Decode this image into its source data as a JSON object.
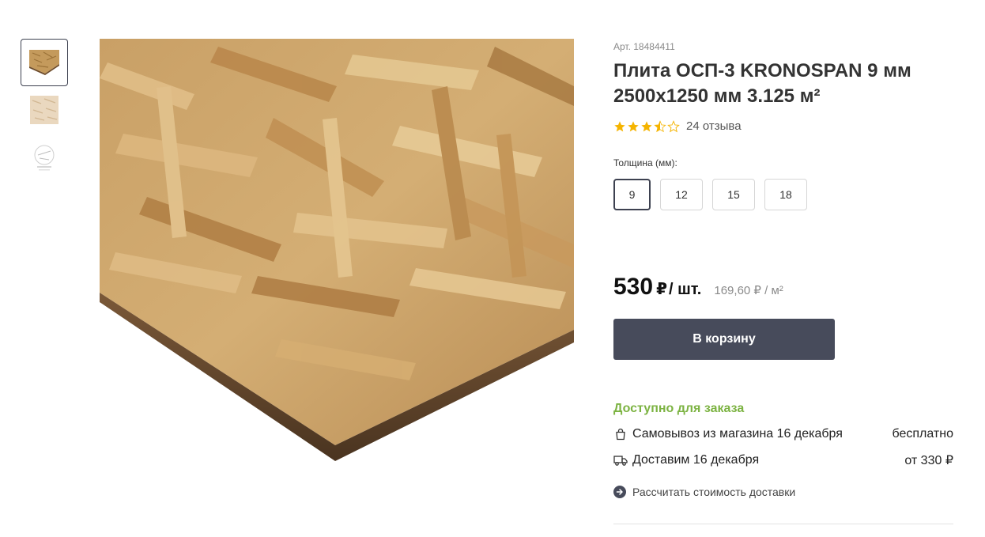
{
  "gallery": {
    "thumbnails": [
      {
        "icon": "osb-board-thumbnail",
        "active": true
      },
      {
        "icon": "osb-surface-thumbnail",
        "active": false
      },
      {
        "icon": "product-diagram-thumbnail",
        "active": false
      }
    ]
  },
  "product": {
    "sku": "Арт. 18484411",
    "title": "Плита ОСП-3 KRONOSPAN 9 мм 2500x1250 мм 3.125 м²",
    "rating": 3.5,
    "rating_max": 5,
    "reviews": "24 отзыва"
  },
  "thickness": {
    "label": "Толщина (мм):",
    "options": [
      "9",
      "12",
      "15",
      "18"
    ],
    "selected": "9"
  },
  "price": {
    "value": "530",
    "currency": "₽",
    "unit": "/ шт.",
    "per_unit": "169,60 ₽ / м²"
  },
  "cart": {
    "button_label": "В корзину"
  },
  "availability": {
    "status": "Доступно для заказа",
    "pickup_label": "Самовывоз из магазина 16 декабря",
    "pickup_value": "бесплатно",
    "delivery_label": "Доставим 16 декабря",
    "delivery_value": "от 330 ₽",
    "calc_label": "Рассчитать стоимость доставки"
  },
  "colors": {
    "accent_dark": "#474b5b",
    "available_green": "#7cb342",
    "star_gold": "#f5b400"
  }
}
